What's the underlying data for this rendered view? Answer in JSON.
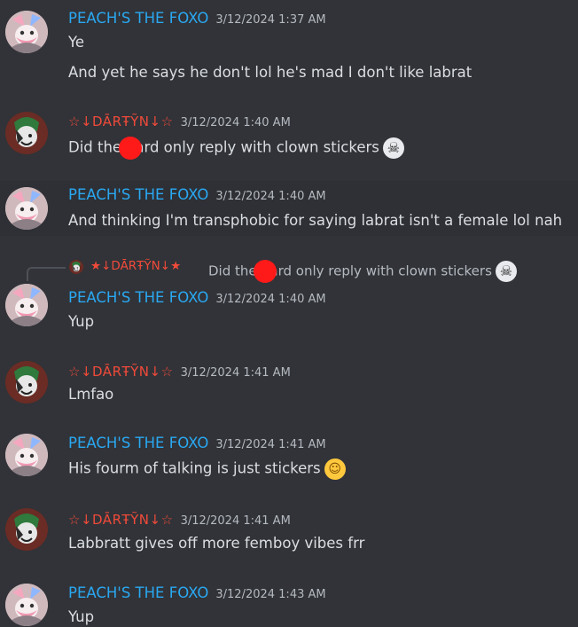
{
  "users": {
    "peach": "PEACH'S THE FOXO",
    "dartyn": "☆↓DĀRŦỸN↓☆"
  },
  "messages": [
    {
      "author": "PEACH'S THE FOXO",
      "timestamp": "3/12/2024 1:37 AM",
      "lines": [
        "Ye",
        "And yet he says he don't lol he's mad I don't like labrat"
      ]
    },
    {
      "author": "☆↓DĀRŦỸN↓☆",
      "timestamp": "3/12/2024 1:40 AM",
      "text_before": "Did the ",
      "text_after": "ard only reply with clown stickers",
      "emoji": "skull"
    },
    {
      "author": "PEACH'S THE FOXO",
      "timestamp": "3/12/2024 1:40 AM",
      "text": "And thinking I'm transphobic for saying labrat isn't a female lol nah"
    },
    {
      "author": "PEACH'S THE FOXO",
      "timestamp": "3/12/2024 1:40 AM",
      "text": "Yup"
    },
    {
      "author": "☆↓DĀRŦỸN↓☆",
      "timestamp": "3/12/2024 1:41 AM",
      "text": "Lmfao"
    },
    {
      "author": "PEACH'S THE FOXO",
      "timestamp": "3/12/2024 1:41 AM",
      "text": "His fourm of talking is just stickers",
      "emoji": "joy"
    },
    {
      "author": "☆↓DĀRŦỸN↓☆",
      "timestamp": "3/12/2024 1:41 AM",
      "text": "Labbratt gives off more femboy vibes frr"
    },
    {
      "author": "PEACH'S THE FOXO",
      "timestamp": "3/12/2024 1:43 AM",
      "text": "Yup"
    }
  ],
  "reply": {
    "author": "★↓DĀRŦỸN↓★",
    "text_before": "Did the ",
    "text_after": "ard only reply with clown stickers"
  },
  "icons": {
    "skull": "skull-emoji",
    "joy": "joy-emoji"
  },
  "colors": {
    "background": "#313338",
    "peach_name": "#2aa8f2",
    "dartyn_name": "#f04a3a",
    "redaction": "#ff1a1a"
  }
}
